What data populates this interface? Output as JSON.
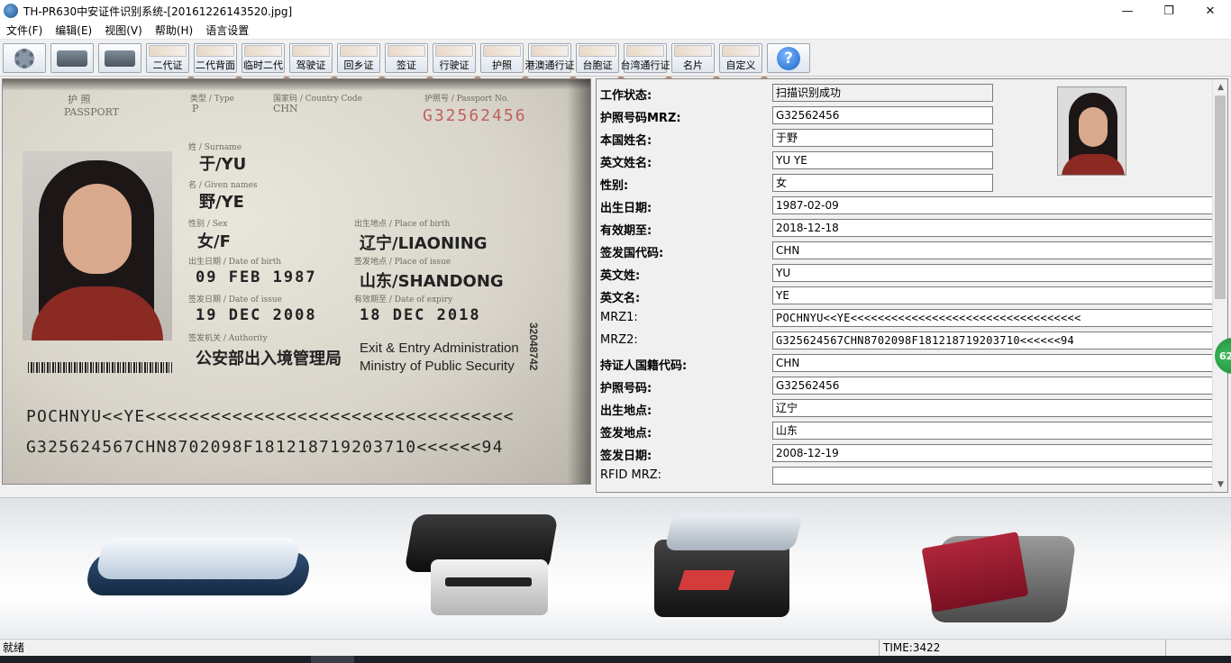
{
  "window": {
    "title": "TH-PR630中安证件识别系统-[20161226143520.jpg]",
    "minimize": "—",
    "maximize": "❐",
    "close": "✕"
  },
  "menu": [
    "文件(F)",
    "编辑(E)",
    "视图(V)",
    "帮助(H)",
    "语言设置"
  ],
  "toolbar": {
    "cards": [
      {
        "label": "二代证",
        "icon": "id-card-front-icon"
      },
      {
        "label": "二代背面",
        "icon": "id-card-back-icon"
      },
      {
        "label": "临时二代",
        "icon": "temporary-id-icon"
      },
      {
        "label": "驾驶证",
        "icon": "driver-license-icon"
      },
      {
        "label": "回乡证",
        "icon": "home-return-permit-icon"
      },
      {
        "label": "签证",
        "icon": "visa-icon"
      },
      {
        "label": "行驶证",
        "icon": "vehicle-license-icon"
      },
      {
        "label": "护照",
        "icon": "passport-icon"
      },
      {
        "label": "港澳通行证",
        "icon": "hk-macau-pass-icon"
      },
      {
        "label": "台胞证",
        "icon": "taiwan-compatriot-icon"
      },
      {
        "label": "台湾通行证",
        "icon": "taiwan-pass-icon"
      },
      {
        "label": "名片",
        "icon": "business-card-icon"
      },
      {
        "label": "自定义",
        "icon": "custom-icon"
      }
    ],
    "help": "?"
  },
  "passport_image": {
    "title_cn": "护 照",
    "title_en": "PASSPORT",
    "type_label": "类型 / Type",
    "type_value": "P",
    "country_label": "国家码 / Country Code",
    "country_value": "CHN",
    "number_label": "护照号 / Passport No.",
    "number_value": "G32562456",
    "surname_label": "姓 / Surname",
    "surname_value": "于/YU",
    "given_label": "名 / Given names",
    "given_value": "野/YE",
    "sex_label": "性别 / Sex",
    "sex_value": "女/F",
    "pob_label": "出生地点 / Place of birth",
    "pob_value": "辽宁/LIAONING",
    "dob_label": "出生日期 / Date of birth",
    "dob_value": "09 FEB 1987",
    "poi_label": "签发地点 / Place of issue",
    "poi_value": "山东/SHANDONG",
    "doi_label": "签发日期 / Date of issue",
    "doi_value": "19 DEC 2008",
    "doe_label": "有效期至 / Date of expiry",
    "doe_value": "18 DEC 2018",
    "authority_label": "签发机关 / Authority",
    "authority_cn": "公安部出入境管理局",
    "authority_en_1": "Exit & Entry Administration",
    "authority_en_2": "Ministry of Public Security",
    "side_number": "32048742",
    "mrz1": "POCHNYU<<YE<<<<<<<<<<<<<<<<<<<<<<<<<<<<<<<<<<",
    "mrz2": "G325624567CHN8702098F181218719203710<<<<<<94"
  },
  "fields": [
    {
      "label": "工作状态:",
      "value": "扫描识别成功",
      "style": "short readonly",
      "bold": true
    },
    {
      "label": "护照号码MRZ:",
      "value": "G32562456",
      "style": "short",
      "bold": true
    },
    {
      "label": "本国姓名:",
      "value": "于野",
      "style": "short",
      "bold": true
    },
    {
      "label": "英文姓名:",
      "value": "YU YE",
      "style": "short",
      "bold": true
    },
    {
      "label": "性别:",
      "value": "女",
      "style": "short",
      "bold": true
    },
    {
      "label": "出生日期:",
      "value": "1987-02-09",
      "style": "long",
      "bold": true
    },
    {
      "label": "有效期至:",
      "value": "2018-12-18",
      "style": "long",
      "bold": true
    },
    {
      "label": "签发国代码:",
      "value": "CHN",
      "style": "long",
      "bold": true
    },
    {
      "label": "英文姓:",
      "value": "YU",
      "style": "long",
      "bold": true
    },
    {
      "label": "英文名:",
      "value": "YE",
      "style": "long",
      "bold": true
    },
    {
      "label": "MRZ1:",
      "value": "POCHNYU<<YE<<<<<<<<<<<<<<<<<<<<<<<<<<<<<<<<<<",
      "style": "long mono",
      "bold": false
    },
    {
      "label": "MRZ2:",
      "value": "G325624567CHN8702098F181218719203710<<<<<<94",
      "style": "long mono",
      "bold": false
    },
    {
      "label": "持证人国籍代码:",
      "value": "CHN",
      "style": "long",
      "bold": true
    },
    {
      "label": "护照号码:",
      "value": "G32562456",
      "style": "long",
      "bold": true
    },
    {
      "label": "出生地点:",
      "value": "辽宁",
      "style": "long",
      "bold": true
    },
    {
      "label": "签发地点:",
      "value": "山东",
      "style": "long",
      "bold": true
    },
    {
      "label": "签发日期:",
      "value": "2008-12-19",
      "style": "long",
      "bold": true
    },
    {
      "label": "RFID MRZ:",
      "value": "",
      "style": "long",
      "bold": false
    }
  ],
  "badge": "62",
  "status": {
    "left": "就绪",
    "time": "TIME:3422"
  }
}
